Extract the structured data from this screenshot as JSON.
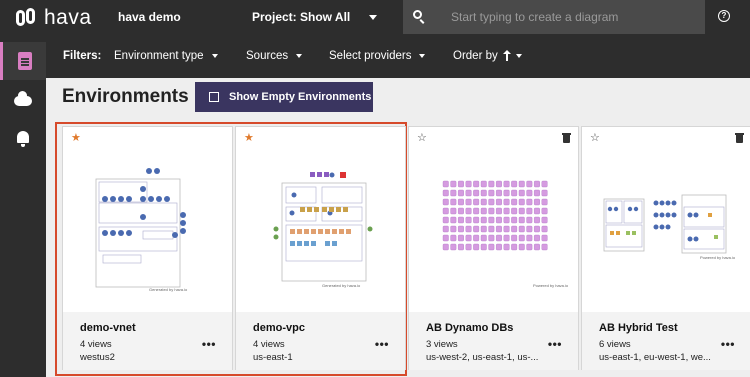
{
  "app": {
    "logo_text": "hava",
    "workspace": "hava demo",
    "project": "Project: Show All"
  },
  "search": {
    "placeholder": "Start typing to create a diagram"
  },
  "filters": {
    "label": "Filters:",
    "environment_type": "Environment type",
    "sources": "Sources",
    "providers": "Select providers",
    "order_by": "Order by"
  },
  "page": {
    "title": "Environments",
    "show_empty_label": "Show Empty Environments"
  },
  "cards": [
    {
      "name": "demo-vnet",
      "views": "4 views",
      "region": "westus2",
      "starred": true,
      "deletable": false,
      "more": "•••"
    },
    {
      "name": "demo-vpc",
      "views": "4 views",
      "region": "us-east-1",
      "starred": true,
      "deletable": false,
      "more": "•••"
    },
    {
      "name": "AB Dynamo DBs",
      "views": "3 views",
      "region": "us-west-2, us-east-1, us-...",
      "starred": false,
      "deletable": true,
      "more": "•••"
    },
    {
      "name": "AB Hybrid Test",
      "views": "6 views",
      "region": "us-east-1, eu-west-1, we...",
      "starred": false,
      "deletable": true,
      "more": "•••"
    }
  ],
  "colors": {
    "accent": "#3a3560",
    "sidebar_active": "#d97ec2",
    "selection": "#d64a2b",
    "star": "#e07a2c"
  }
}
